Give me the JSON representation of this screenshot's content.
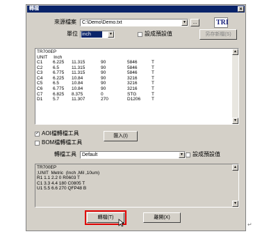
{
  "dialog": {
    "title": "轉檔",
    "close_glyph": "×"
  },
  "source": {
    "label": "來源檔案",
    "path": "C:\\Demo\\Demo.txt",
    "browse_label": "..."
  },
  "unit": {
    "label": "單位",
    "value": "inch",
    "default_checkbox_label": "設成預設值"
  },
  "logo": {
    "text": "TRI"
  },
  "save_new_button": "另存新檔(S)",
  "file_preview": {
    "header_lines": [
      "TR700EP",
      "UNIT     Inch"
    ],
    "rows": [
      [
        "C1",
        "6.225",
        "11.315",
        "90",
        "5846",
        "T"
      ],
      [
        "C2",
        "6.5",
        "11.315",
        "90",
        "5846",
        "T"
      ],
      [
        "C3",
        "6.775",
        "11.315",
        "90",
        "5846",
        "T"
      ],
      [
        "C4",
        "6.225",
        "10.84",
        "90",
        "3216",
        "T"
      ],
      [
        "C5",
        "6.5",
        "10.84",
        "90",
        "3216",
        "T"
      ],
      [
        "C6",
        "6.775",
        "10.84",
        "90",
        "3216",
        "T"
      ],
      [
        "C7",
        "6.825",
        "8.375",
        "0",
        "STG",
        "T"
      ],
      [
        "D1",
        "5.7",
        "11.307",
        "270",
        "D1206",
        "T"
      ]
    ]
  },
  "options": {
    "aoi_label": "AOI檔轉檔工具",
    "aoi_checked": true,
    "bom_label": "BOM檔轉檔工具",
    "bom_checked": false,
    "import_button": "匯入(I)"
  },
  "tool": {
    "label": "轉檔工具",
    "value": "Default",
    "default_checkbox_label": "設成預設值"
  },
  "output": {
    "lines": [
      "TR700EP",
      ";UNIT  Metric  (Inch ,Mil ,10um)",
      "R1 1.1 2.2 0 R0603 T",
      "C1 3.3 4.4 180 C0805 T",
      "U1 5.5 6.6 270 QFP48 B"
    ]
  },
  "buttons": {
    "convert": "轉檔(T)",
    "close": "離開(X)"
  }
}
